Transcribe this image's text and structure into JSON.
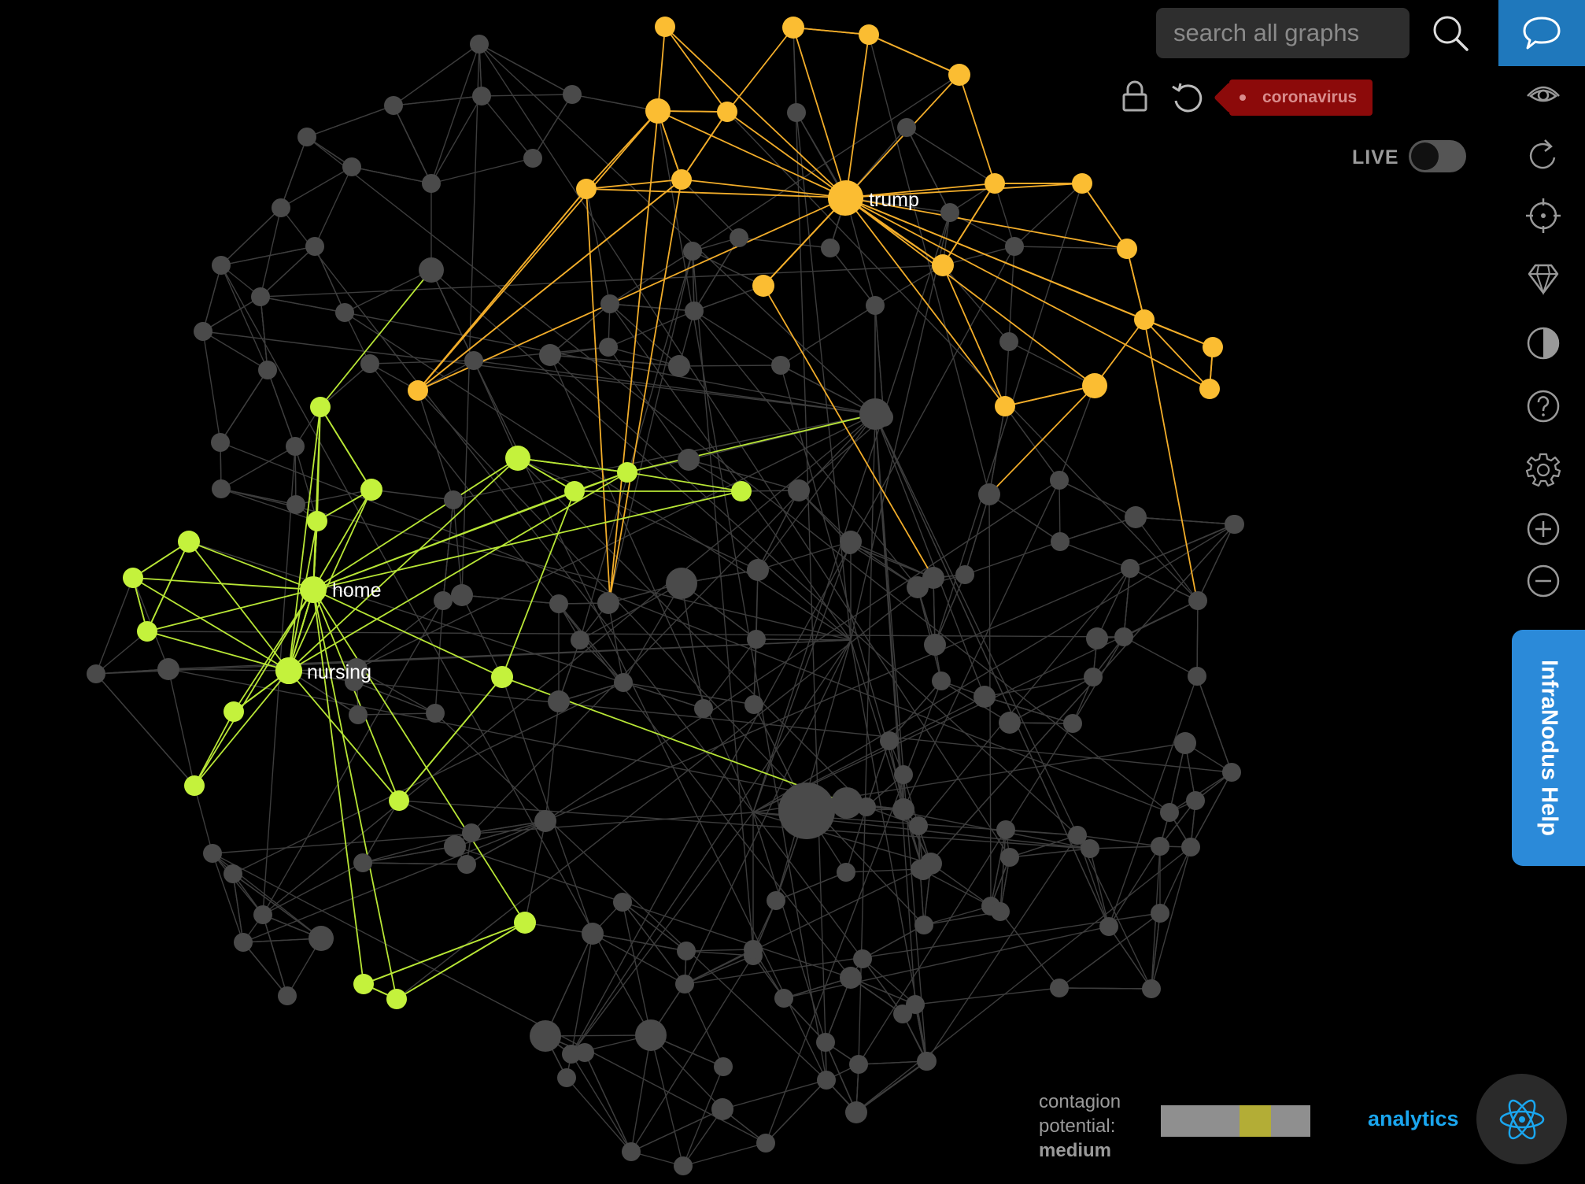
{
  "graph": {
    "labels": {
      "trump": "trump",
      "home": "home",
      "nursing": "nursing"
    },
    "colors": {
      "background": "#000000",
      "gray_node": "#4a4a4a",
      "yellow_cluster": "#fbbd32",
      "green_cluster": "#c4f23c"
    }
  },
  "search": {
    "placeholder": "search all graphs",
    "icon": "search-icon"
  },
  "toolbar": {
    "context_tag": "coronavirus",
    "live_label": "LIVE",
    "live_enabled": false,
    "icons": [
      "lock-icon",
      "undo-icon"
    ]
  },
  "sidebar": {
    "icons": [
      "chat-icon",
      "eye-icon",
      "refresh-icon",
      "target-icon",
      "diamond-icon",
      "contrast-icon",
      "help-icon",
      "settings-icon",
      "zoom-in-icon",
      "zoom-out-icon"
    ],
    "accent_color": "#1f78bc"
  },
  "help_tab": {
    "label": "InfraNodus Help",
    "color": "#2b8ad9"
  },
  "footer": {
    "contagion_label_1": "contagion",
    "contagion_label_2": "potential:",
    "contagion_level": "medium",
    "contagion_fraction": 0.6,
    "analytics_label": "analytics",
    "analytics_color": "#1aa6ef",
    "analytics_icon": "atom-icon"
  }
}
